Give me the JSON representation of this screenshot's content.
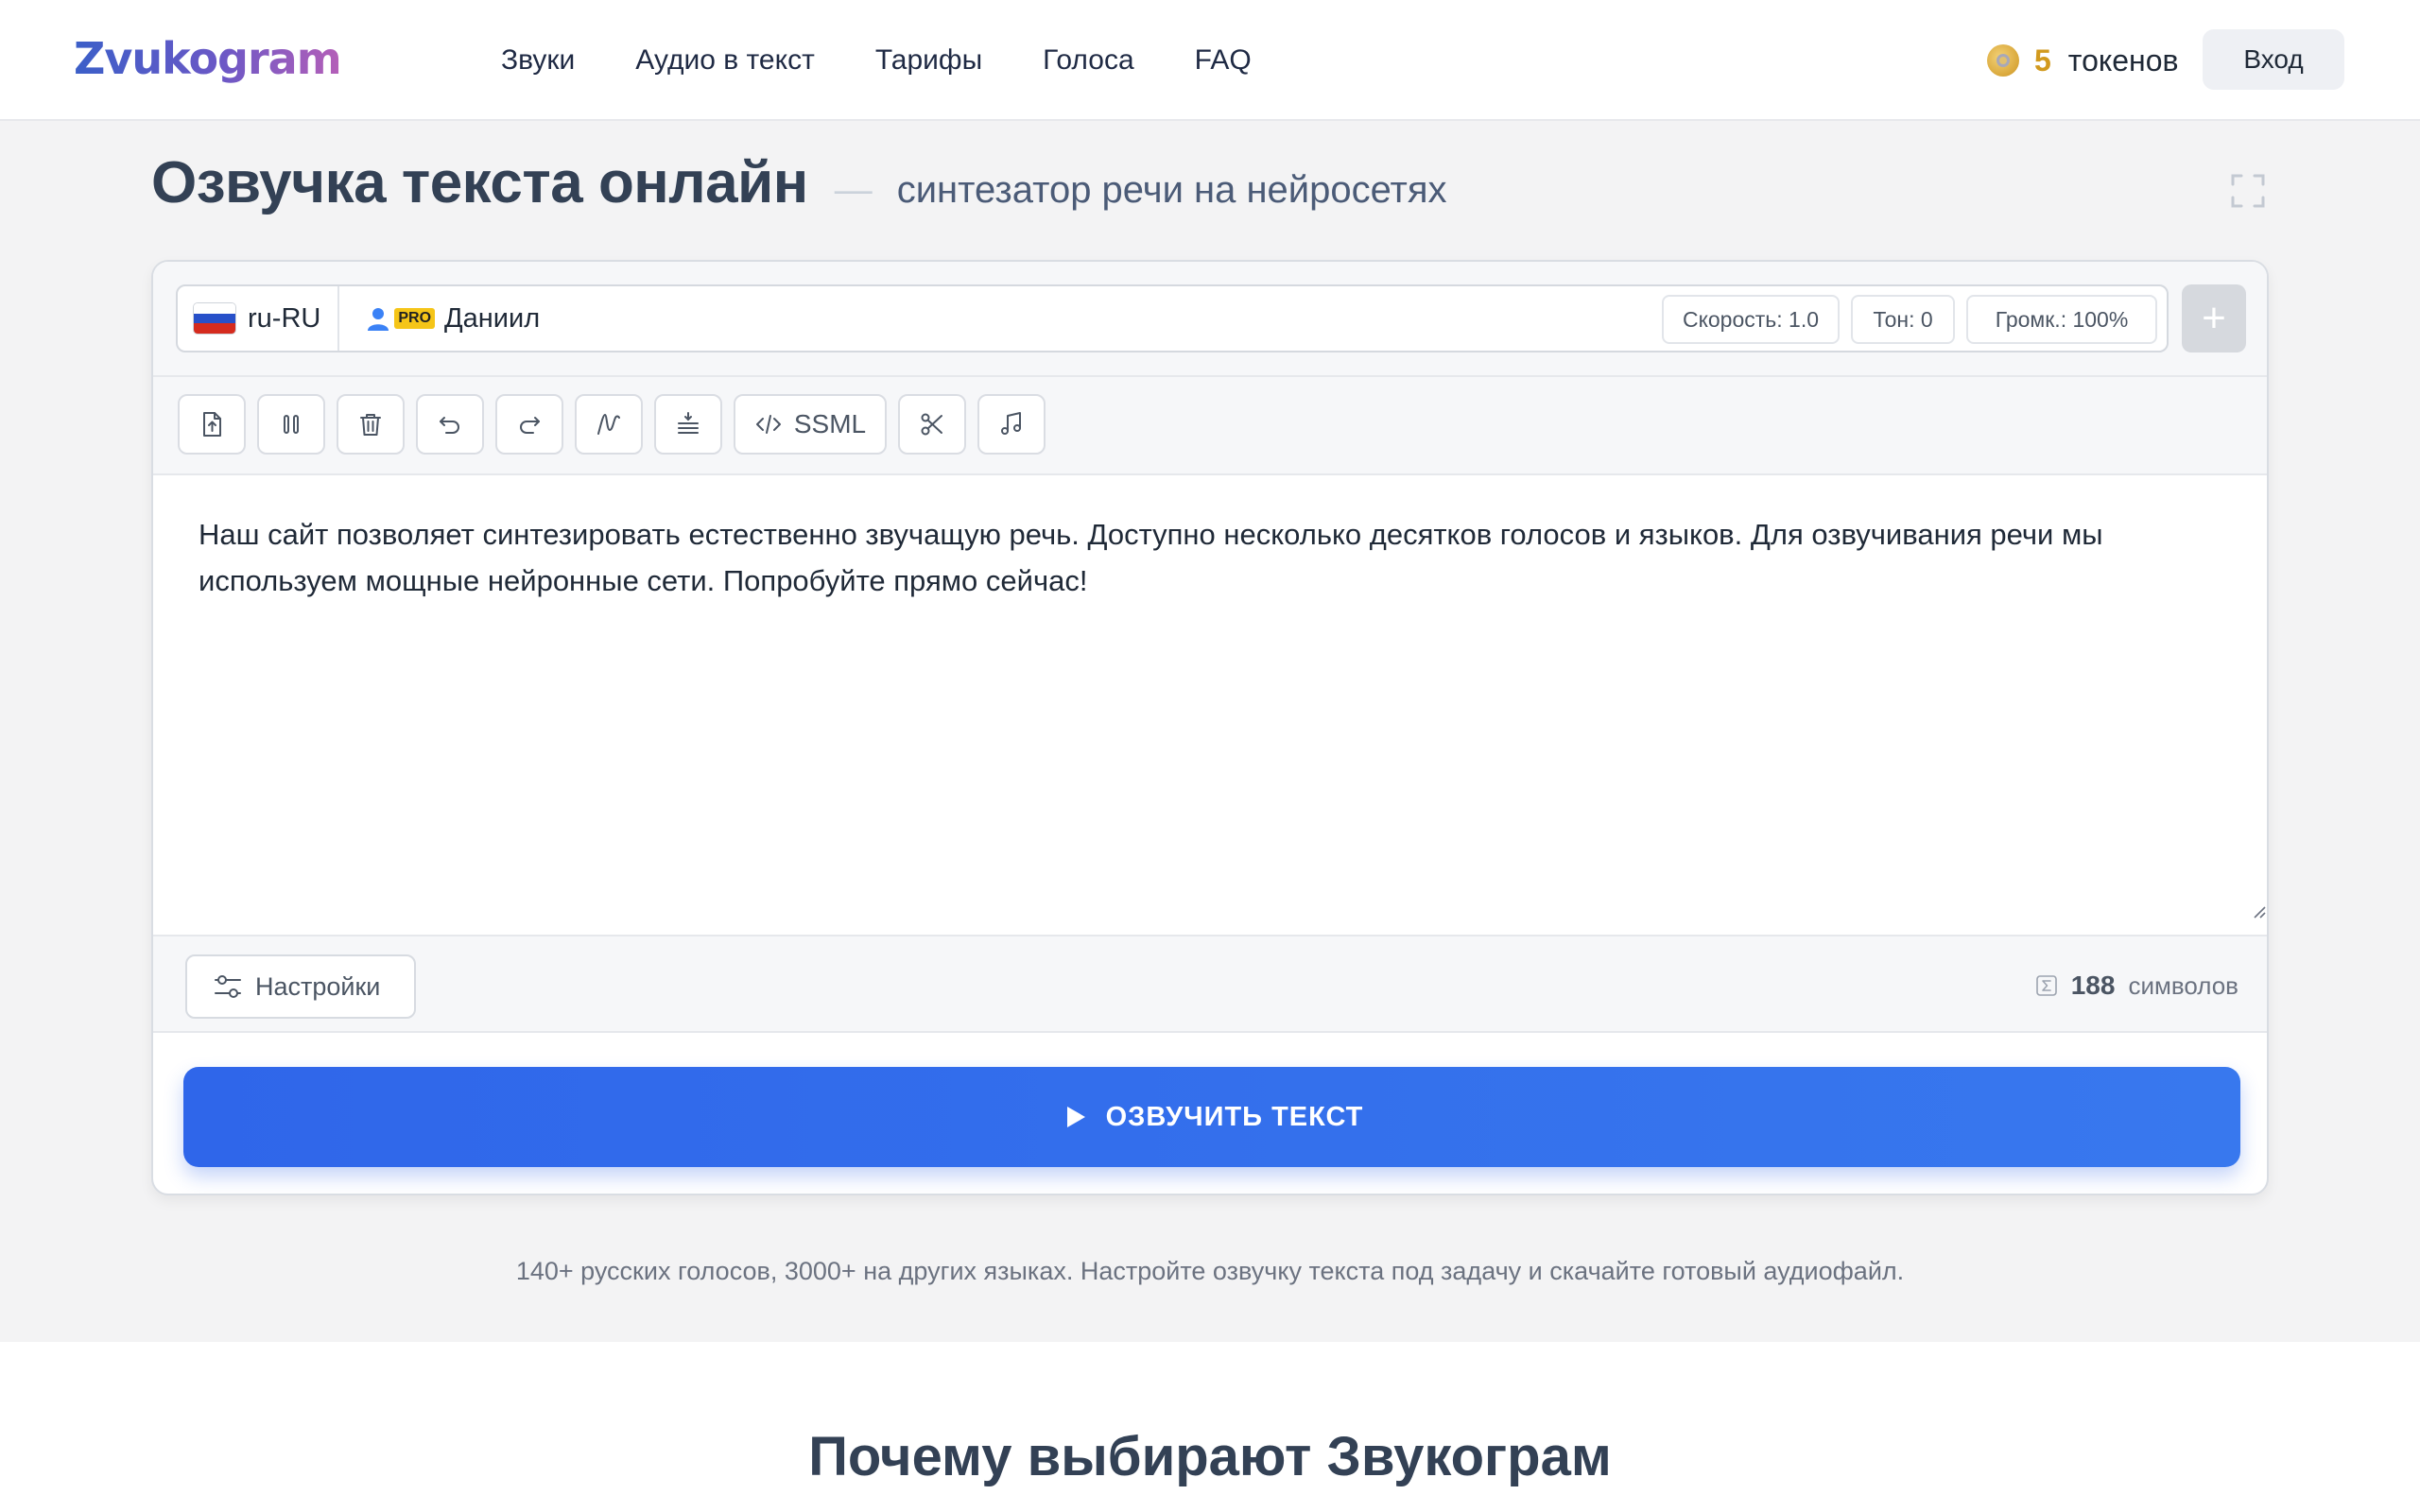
{
  "header": {
    "logo_text": "Zvukogram",
    "nav": [
      "Звуки",
      "Аудио в текст",
      "Тарифы",
      "Голоса",
      "FAQ"
    ],
    "tokens_count": "5",
    "tokens_label": "токенов",
    "login_label": "Вход"
  },
  "hero": {
    "title": "Озвучка текста онлайн",
    "dash": "—",
    "subtitle": "синтезатор речи на нейросетях"
  },
  "voice_bar": {
    "language": "ru-RU",
    "pro_badge": "PRO",
    "voice_name": "Даниил",
    "speed": "Скорость: 1.0",
    "tone": "Тон: 0",
    "volume": "Громк.: 100%",
    "add_label": "+"
  },
  "toolbar": {
    "ssml_label": "SSML"
  },
  "editor": {
    "text": "Наш сайт позволяет синтезировать естественно звучащую речь. Доступно несколько десятков голосов и языков. Для озвучивания речи мы используем мощные нейронные сети. Попробуйте прямо сейчас!"
  },
  "footer": {
    "settings_label": "Настройки",
    "char_count": "188",
    "char_label": "символов"
  },
  "speak_button": "ОЗВУЧИТЬ ТЕКСТ",
  "info_line": "140+ русских голосов, 3000+ на других языках. Настройте озвучку текста под задачу и скачайте готовый аудиофайл.",
  "why_title": "Почему выбирают Звукограм",
  "colors": {
    "accent": "#2f66ea",
    "token": "#d29a1e",
    "title": "#334155"
  }
}
